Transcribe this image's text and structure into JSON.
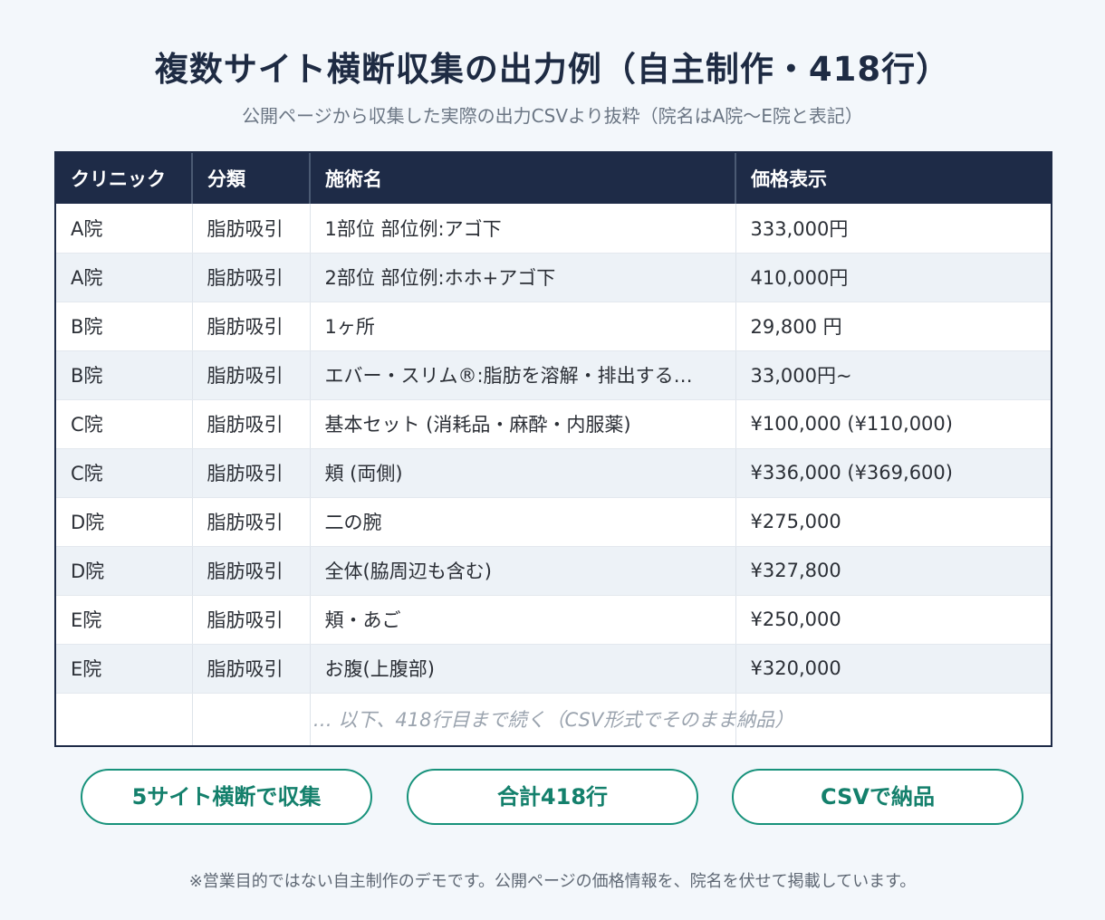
{
  "header": {
    "title": "複数サイト横断収集の出力例（自主制作・418行）",
    "subtitle": "公開ページから収集した実際の出力CSVより抜粋（院名はA院〜E院と表記）"
  },
  "table": {
    "columns": [
      "クリニック",
      "分類",
      "施術名",
      "価格表示"
    ],
    "rows": [
      {
        "clinic": "A院",
        "category": "脂肪吸引",
        "treatment": "1部位 部位例:アゴ下",
        "price": "333,000円"
      },
      {
        "clinic": "A院",
        "category": "脂肪吸引",
        "treatment": "2部位 部位例:ホホ+アゴ下",
        "price": "410,000円"
      },
      {
        "clinic": "B院",
        "category": "脂肪吸引",
        "treatment": "1ヶ所",
        "price": "29,800 円"
      },
      {
        "clinic": "B院",
        "category": "脂肪吸引",
        "treatment": "エバー・スリム®:脂肪を溶解・排出する…",
        "price": "33,000円~"
      },
      {
        "clinic": "C院",
        "category": "脂肪吸引",
        "treatment": "基本セット (消耗品・麻酔・内服薬)",
        "price": "¥100,000 (¥110,000)"
      },
      {
        "clinic": "C院",
        "category": "脂肪吸引",
        "treatment": "頬 (両側)",
        "price": "¥336,000 (¥369,600)"
      },
      {
        "clinic": "D院",
        "category": "脂肪吸引",
        "treatment": "二の腕",
        "price": "¥275,000"
      },
      {
        "clinic": "D院",
        "category": "脂肪吸引",
        "treatment": "全体(脇周辺も含む)",
        "price": "¥327,800"
      },
      {
        "clinic": "E院",
        "category": "脂肪吸引",
        "treatment": "頬・あご",
        "price": "¥250,000"
      },
      {
        "clinic": "E院",
        "category": "脂肪吸引",
        "treatment": "お腹(上腹部)",
        "price": "¥320,000"
      }
    ],
    "more_text": "… 以下、418行目まで続く（CSV形式でそのまま納品）"
  },
  "badges": [
    {
      "label": "5サイト横断で収集"
    },
    {
      "label": "合計418行"
    },
    {
      "label": "CSVで納品"
    }
  ],
  "footnote": "※営業目的ではない自主制作のデモです。公開ページの価格情報を、院名を伏せて掲載しています。",
  "colors": {
    "header_bg": "#1e2b47",
    "accent": "#17927b",
    "stripe": "#edf2f7",
    "page_bg": "#f3f7fb"
  }
}
